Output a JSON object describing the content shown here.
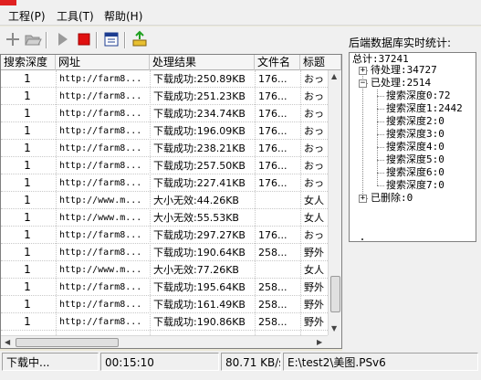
{
  "menu": {
    "items": [
      {
        "label": "工程(P)"
      },
      {
        "label": "工具(T)"
      },
      {
        "label": "帮助(H)"
      }
    ]
  },
  "toolbar": {
    "buttons": [
      {
        "icon": "add-icon"
      },
      {
        "icon": "open-folder-icon"
      },
      {
        "icon": "play-icon"
      },
      {
        "icon": "stop-icon"
      },
      {
        "icon": "properties-icon"
      },
      {
        "icon": "export-icon"
      }
    ]
  },
  "table": {
    "columns": [
      "搜索深度",
      "网址",
      "处理结果",
      "文件名",
      "标题"
    ],
    "rows": [
      {
        "depth": "1",
        "url": "http://farm8...",
        "result": "下载成功:250.89KB",
        "file": "176...",
        "title": "おっ"
      },
      {
        "depth": "1",
        "url": "http://farm8...",
        "result": "下载成功:251.23KB",
        "file": "176...",
        "title": "おっ"
      },
      {
        "depth": "1",
        "url": "http://farm8...",
        "result": "下载成功:234.74KB",
        "file": "176...",
        "title": "おっ"
      },
      {
        "depth": "1",
        "url": "http://farm8...",
        "result": "下载成功:196.09KB",
        "file": "176...",
        "title": "おっ"
      },
      {
        "depth": "1",
        "url": "http://farm8...",
        "result": "下载成功:238.21KB",
        "file": "176...",
        "title": "おっ"
      },
      {
        "depth": "1",
        "url": "http://farm8...",
        "result": "下载成功:257.50KB",
        "file": "176...",
        "title": "おっ"
      },
      {
        "depth": "1",
        "url": "http://farm8...",
        "result": "下载成功:227.41KB",
        "file": "176...",
        "title": "おっ"
      },
      {
        "depth": "1",
        "url": "http://www.m...",
        "result": "大小无效:44.26KB",
        "file": "",
        "title": "女人"
      },
      {
        "depth": "1",
        "url": "http://www.m...",
        "result": "大小无效:55.53KB",
        "file": "",
        "title": "女人"
      },
      {
        "depth": "1",
        "url": "http://farm8...",
        "result": "下载成功:297.27KB",
        "file": "176...",
        "title": "おっ"
      },
      {
        "depth": "1",
        "url": "http://farm8...",
        "result": "下载成功:190.64KB",
        "file": "258...",
        "title": "野外"
      },
      {
        "depth": "1",
        "url": "http://www.m...",
        "result": "大小无效:77.26KB",
        "file": "",
        "title": "女人"
      },
      {
        "depth": "1",
        "url": "http://farm8...",
        "result": "下载成功:195.64KB",
        "file": "258...",
        "title": "野外"
      },
      {
        "depth": "1",
        "url": "http://farm8...",
        "result": "下载成功:161.49KB",
        "file": "258...",
        "title": "野外"
      },
      {
        "depth": "1",
        "url": "http://farm8...",
        "result": "下载成功:190.86KB",
        "file": "258...",
        "title": "野外"
      }
    ]
  },
  "stats": {
    "title": "后端数据库实时统计:",
    "total": "总计:37241",
    "pending": "待处理:34727",
    "processed": "已处理:2514",
    "depths": [
      "搜索深度0:72",
      "搜索深度1:2442",
      "搜索深度2:0",
      "搜索深度3:0",
      "搜索深度4:0",
      "搜索深度5:0",
      "搜索深度6:0",
      "搜索深度7:0"
    ],
    "deleted": "已删除:0"
  },
  "status": {
    "state": "下载中...",
    "elapsed": "00:15:10",
    "speed": "80.71 KB/s",
    "path": "E:\\test2\\美图.PSv6"
  },
  "colors": {
    "stop": "#e01010",
    "play": "#9a9a9a",
    "add": "#8a8a8a"
  }
}
